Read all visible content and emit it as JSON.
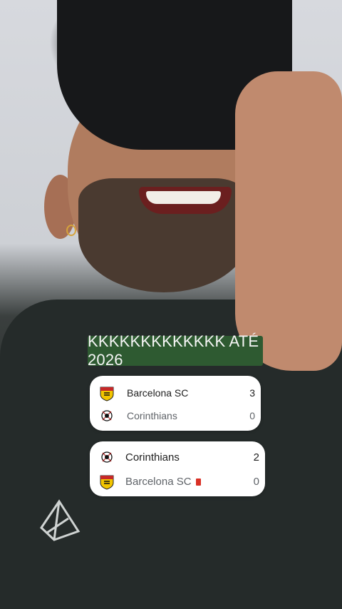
{
  "caption": "KKKKKKKKKKKKK ATÉ 2026",
  "matches": [
    {
      "home": {
        "name": "Barcelona SC",
        "score": "3",
        "crest": "barcelona-sc-crest-icon"
      },
      "away": {
        "name": "Corinthians",
        "score": "0",
        "crest": "corinthians-crest-icon"
      }
    },
    {
      "home": {
        "name": "Corinthians",
        "score": "2",
        "crest": "corinthians-crest-icon"
      },
      "away": {
        "name": "Barcelona SC",
        "score": "0",
        "crest": "barcelona-sc-crest-icon",
        "red_card": true
      }
    }
  ],
  "colors": {
    "caption_bg": "#2e5a31",
    "card_bg": "#ffffff",
    "red_card": "#d93025",
    "shirt": "#252b2a"
  }
}
